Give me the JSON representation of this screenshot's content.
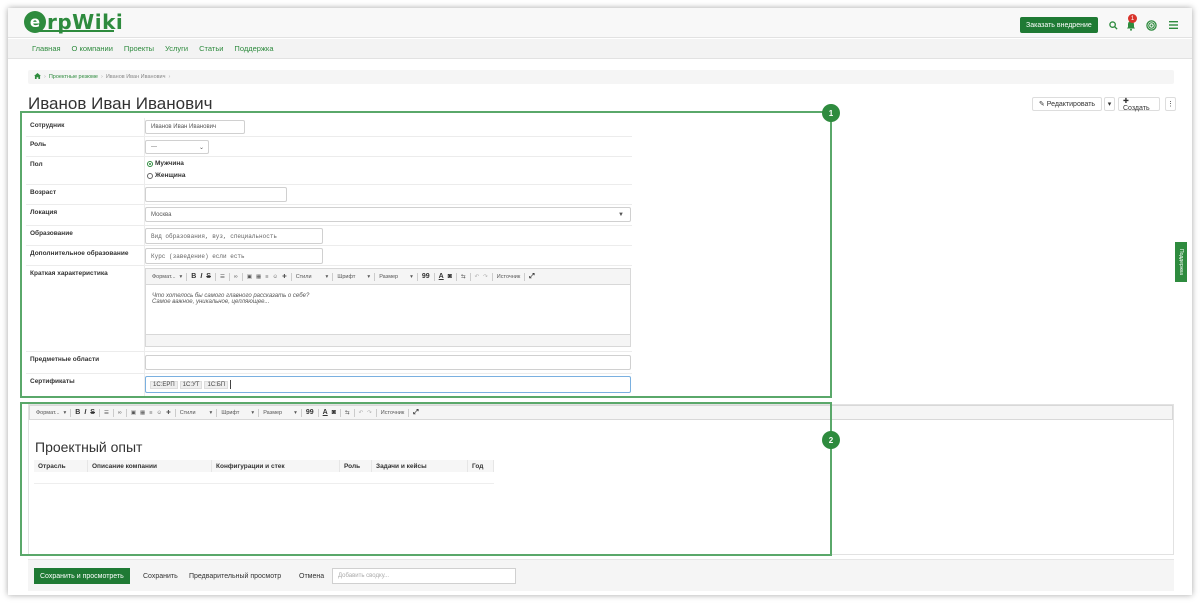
{
  "header": {
    "logo_initial": "e",
    "logo_text": "rpWiki",
    "order_button": "Заказать внедрение",
    "notifications_count": "1",
    "icons": [
      "search-icon",
      "bell-icon",
      "target-icon",
      "menu-icon"
    ]
  },
  "nav": {
    "items": [
      "Главная",
      "О компании",
      "Проекты",
      "Услуги",
      "Статьи",
      "Поддержка"
    ]
  },
  "breadcrumb": {
    "home_icon": "home-icon",
    "items": [
      "Проектные резюме",
      "Иванов Иван Иванович"
    ]
  },
  "page": {
    "title": "Иванов Иван Иванович"
  },
  "actions": {
    "edit": "✎ Редактировать",
    "caret": "▾",
    "create": "✚ Создать",
    "more": "⋮"
  },
  "markers": {
    "one": "1",
    "two": "2"
  },
  "form": {
    "employee_label": "Сотрудник",
    "employee_value": "Иванов Иван Иванович",
    "role_label": "Роль",
    "role_value": "---",
    "gender_label": "Пол",
    "gender_options": [
      "Мужчина",
      "Женщина"
    ],
    "gender_selected": "Мужчина",
    "age_label": "Возраст",
    "location_label": "Локация",
    "location_value": "Москва",
    "education_label": "Образование",
    "education_placeholder": "Вид образования, вуз, специальность",
    "extra_education_label": "Дополнительное образование",
    "extra_education_placeholder": "Курс (заведение) если есть",
    "summary_label": "Краткая характеристика",
    "summary_text_1": "Что хотелось бы самого главного рассказать о себе?",
    "summary_text_2": "Самое важное, уникальное, цепляющее...",
    "domains_label": "Предметные области",
    "certs_label": "Сертификаты",
    "certs": [
      "1С:ЕРП",
      "1С:УТ",
      "1С:БП"
    ]
  },
  "toolbar": {
    "format": "Формат...",
    "bold": "B",
    "italic": "I",
    "strike": "S",
    "styles": "Стили",
    "font": "Шрифт",
    "size": "Размер",
    "quote": "99",
    "source": "Источник"
  },
  "experience": {
    "title": "Проектный опыт",
    "columns": [
      "Отрасль",
      "Описание компании",
      "Конфигурации и стек",
      "Роль",
      "Задачи и кейсы",
      "Год"
    ]
  },
  "bottom": {
    "save_view": "Сохранить и просмотреть",
    "save": "Сохранить",
    "preview": "Предварительный просмотр",
    "cancel": "Отмена",
    "summary_placeholder": "Добавить сводку..."
  },
  "side_tab": "Поддержка",
  "colors": {
    "brand": "#2e8b3e",
    "brand_dark": "#1f7a34",
    "badge": "#d9342b"
  }
}
